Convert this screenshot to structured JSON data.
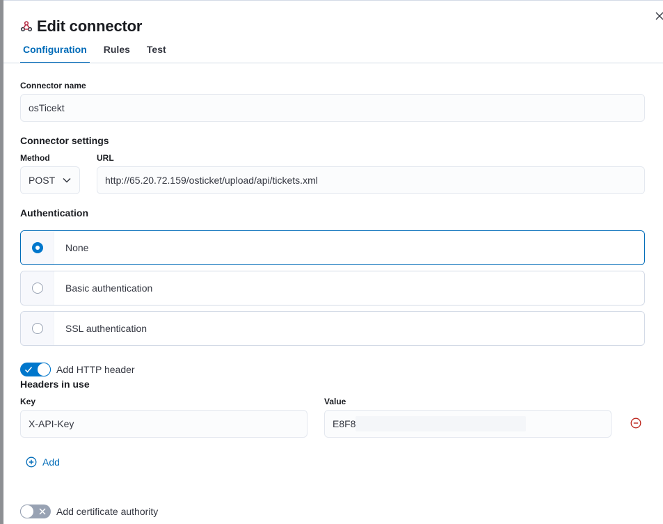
{
  "flyout": {
    "title": "Edit connector",
    "tabs": [
      {
        "label": "Configuration",
        "active": true
      },
      {
        "label": "Rules",
        "active": false
      },
      {
        "label": "Test",
        "active": false
      }
    ]
  },
  "connector_name": {
    "label": "Connector name",
    "value": "osTicekt"
  },
  "connector_settings": {
    "title": "Connector settings",
    "method_label": "Method",
    "method_value": "POST",
    "url_label": "URL",
    "url_value": "http://65.20.72.159/osticket/upload/api/tickets.xml"
  },
  "authentication": {
    "title": "Authentication",
    "options": [
      {
        "label": "None",
        "selected": true
      },
      {
        "label": "Basic authentication",
        "selected": false
      },
      {
        "label": "SSL authentication",
        "selected": false
      }
    ]
  },
  "http_header": {
    "toggle_label": "Add HTTP header",
    "toggle_on": true,
    "headers_title": "Headers in use",
    "key_label": "Key",
    "value_label": "Value",
    "key_value": "X-API-Key",
    "value_value": "E8F8",
    "add_label": "Add"
  },
  "certificate": {
    "toggle_label": "Add certificate authority",
    "toggle_on": false
  },
  "colors": {
    "primary": "#006bb8",
    "danger": "#bd271e",
    "brand_icon": "#b8334a"
  },
  "icons": {
    "connector": "webhook-icon",
    "close": "close-icon",
    "chevron": "chevron-down-icon",
    "remove": "minus-circle-icon",
    "add": "plus-circle-icon",
    "check": "check-icon",
    "cross": "cross-icon"
  }
}
